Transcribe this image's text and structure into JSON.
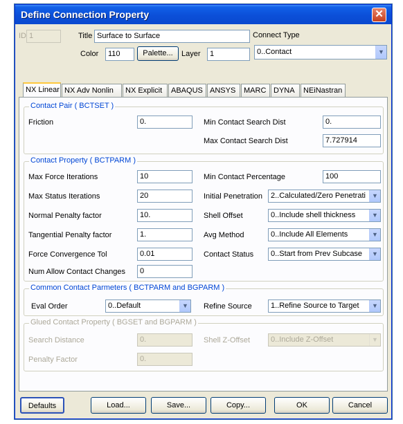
{
  "window": {
    "title": "Define Connection Property",
    "close_icon": "close-icon"
  },
  "header": {
    "id_label": "ID",
    "id_value": "1",
    "title_label": "Title",
    "title_value": "Surface to Surface",
    "color_label": "Color",
    "color_value": "110",
    "palette_button": "Palette...",
    "layer_label": "Layer",
    "layer_value": "1",
    "connect_type_label": "Connect Type",
    "connect_type_value": "0..Contact"
  },
  "tabs": [
    "NX Linear",
    "NX Adv Nonlin",
    "NX Explicit",
    "ABAQUS",
    "ANSYS",
    "MARC",
    "DYNA",
    "NEiNastran"
  ],
  "contact_pair": {
    "title": "Contact Pair ( BCTSET )",
    "friction_label": "Friction",
    "friction_value": "0.",
    "min_dist_label": "Min Contact Search Dist",
    "min_dist_value": "0.",
    "max_dist_label": "Max Contact Search Dist",
    "max_dist_value": "7.727914"
  },
  "contact_property": {
    "title": "Contact Property ( BCTPARM )",
    "max_force_label": "Max Force Iterations",
    "max_force_value": "10",
    "max_status_label": "Max Status Iterations",
    "max_status_value": "20",
    "normal_penalty_label": "Normal Penalty factor",
    "normal_penalty_value": "10.",
    "tangential_penalty_label": "Tangential Penalty factor",
    "tangential_penalty_value": "1.",
    "force_tol_label": "Force Convergence Tol",
    "force_tol_value": "0.01",
    "num_allow_label": "Num Allow Contact Changes",
    "num_allow_value": "0",
    "min_percent_label": "Min Contact Percentage",
    "min_percent_value": "100",
    "initial_pen_label": "Initial Penetration",
    "initial_pen_value": "2..Calculated/Zero Penetrati",
    "shell_offset_label": "Shell Offset",
    "shell_offset_value": "0..Include shell thickness",
    "avg_method_label": "Avg Method",
    "avg_method_value": "0..Include All Elements",
    "contact_status_label": "Contact Status",
    "contact_status_value": "0..Start from Prev Subcase"
  },
  "common": {
    "title": "Common Contact Parmeters ( BCTPARM and BGPARM )",
    "eval_order_label": "Eval Order",
    "eval_order_value": "0..Default",
    "refine_label": "Refine Source",
    "refine_value": "1..Refine Source to Target"
  },
  "glued": {
    "title": "Glued Contact Property ( BGSET and BGPARM )",
    "search_dist_label": "Search Distance",
    "search_dist_value": "0.",
    "penalty_label": "Penalty Factor",
    "penalty_value": "0.",
    "shell_z_label": "Shell Z-Offset",
    "shell_z_value": "0..Include Z-Offset"
  },
  "buttons": {
    "defaults": "Defaults",
    "load": "Load...",
    "save": "Save...",
    "copy": "Copy...",
    "ok": "OK",
    "cancel": "Cancel"
  }
}
